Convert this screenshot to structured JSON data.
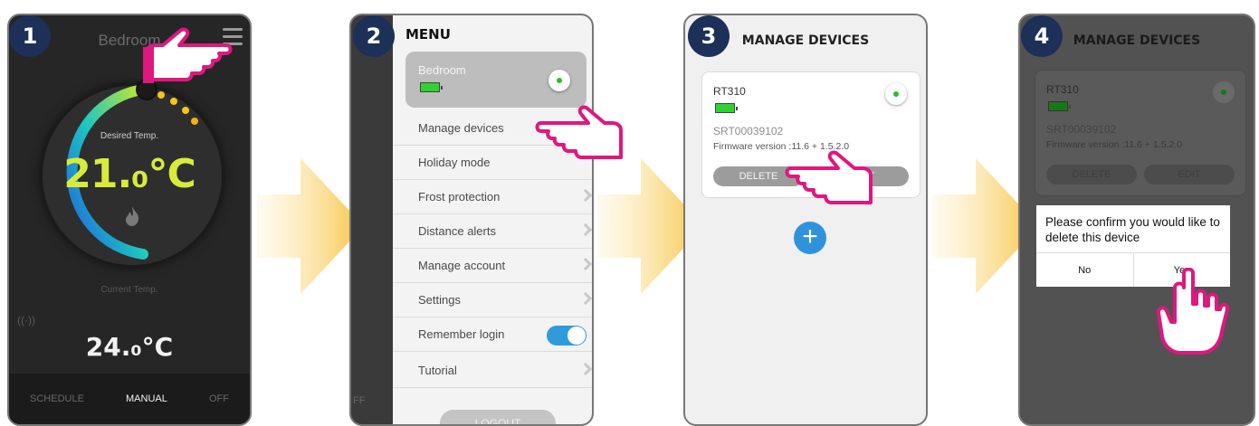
{
  "steps": [
    "1",
    "2",
    "3",
    "4"
  ],
  "screen1": {
    "title": "Bedroom",
    "desired_label": "Desired Temp.",
    "desired_temp": "21.₀°C",
    "current_label": "Current Temp.",
    "current_temp": "24.₀°C",
    "tabs": [
      "SCHEDULE",
      "MANUAL",
      "OFF"
    ],
    "active_tab": "MANUAL"
  },
  "screen2": {
    "title": "MENU",
    "device_name": "Bedroom",
    "items": [
      "Manage devices",
      "Holiday mode",
      "Frost protection",
      "Distance alerts",
      "Manage account",
      "Settings",
      "Remember login",
      "Tutorial"
    ],
    "logout_label": "LOGOUT",
    "background_tab": "FF"
  },
  "screen3": {
    "title": "MANAGE DEVICES",
    "device": {
      "name": "RT310",
      "serial": "SRT00039102",
      "firmware": "Firmware version :11.6 + 1.5.2.0"
    },
    "delete_label": "DELETE",
    "edit_label": "EDIT",
    "add_label": "+"
  },
  "screen4": {
    "title": "MANAGE DEVICES",
    "device": {
      "name": "RT310",
      "serial": "SRT00039102",
      "firmware": "Firmware version :11.6 + 1.5.2.0"
    },
    "delete_label": "DELETE",
    "edit_label": "EDIT",
    "dialog": {
      "message": "Please confirm you would like to delete this device",
      "no_label": "No",
      "yes_label": "Yes"
    }
  },
  "colors": {
    "badge": "#1c3058",
    "hand": "#e0177f",
    "arrow": "#f9c84a",
    "accent_blue": "#2f93db",
    "temp_yellow": "#d7ec3a"
  }
}
